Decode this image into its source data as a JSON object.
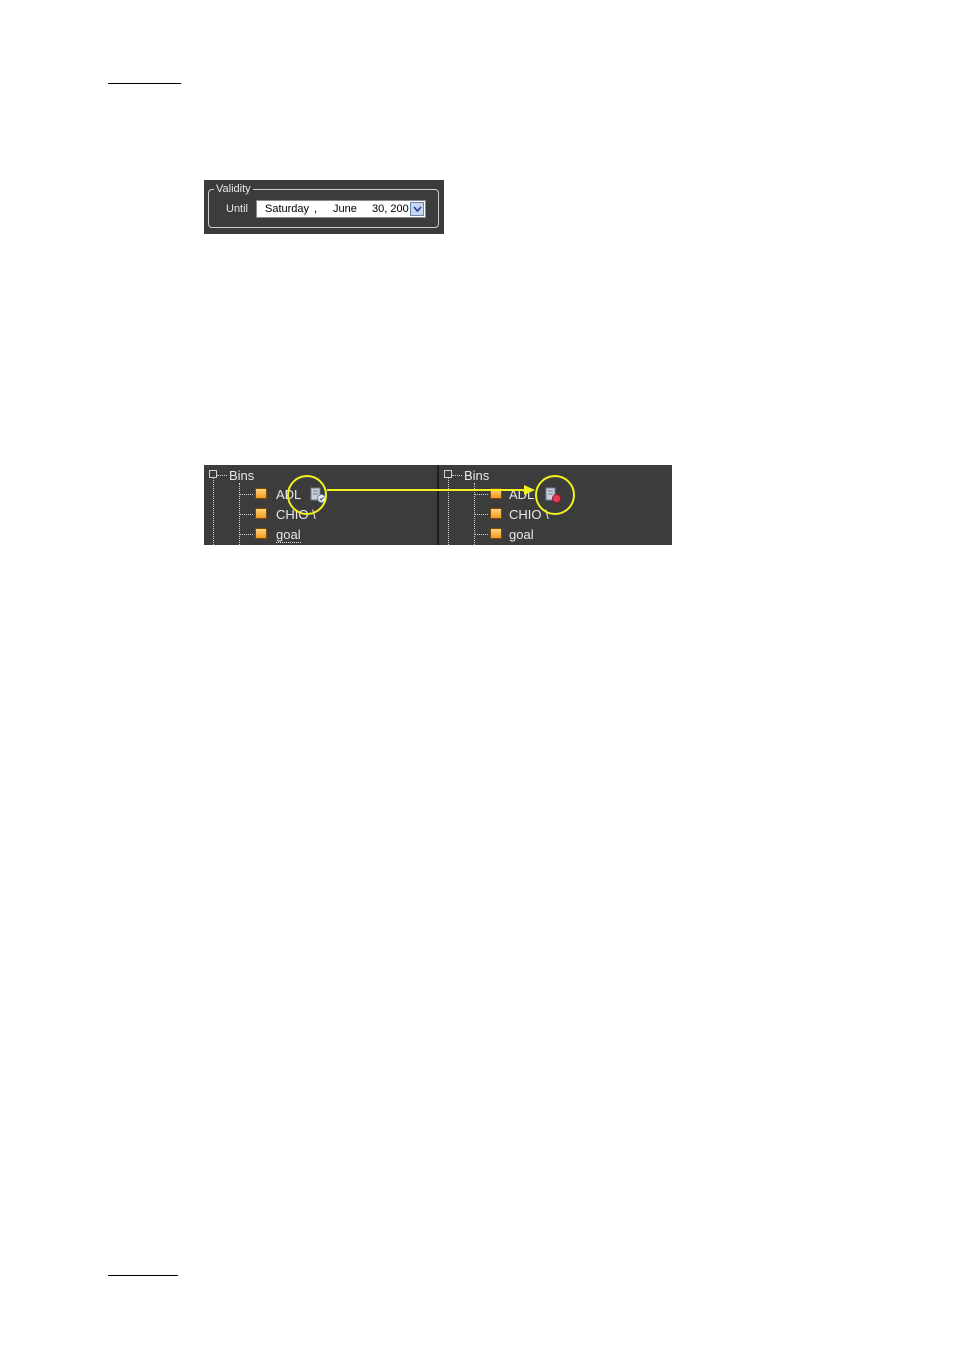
{
  "validity": {
    "group_label": "Validity",
    "until_label": "Until",
    "date": {
      "weekday": "Saturday",
      "sep": ",",
      "month": "June",
      "rest": "30, 200"
    }
  },
  "bins_tree": {
    "root_label": "Bins",
    "before": {
      "items": [
        "ADL",
        "CHIO \\",
        "goal"
      ]
    },
    "after": {
      "items": [
        "ADL",
        "CHIO \\",
        "goal"
      ]
    }
  }
}
